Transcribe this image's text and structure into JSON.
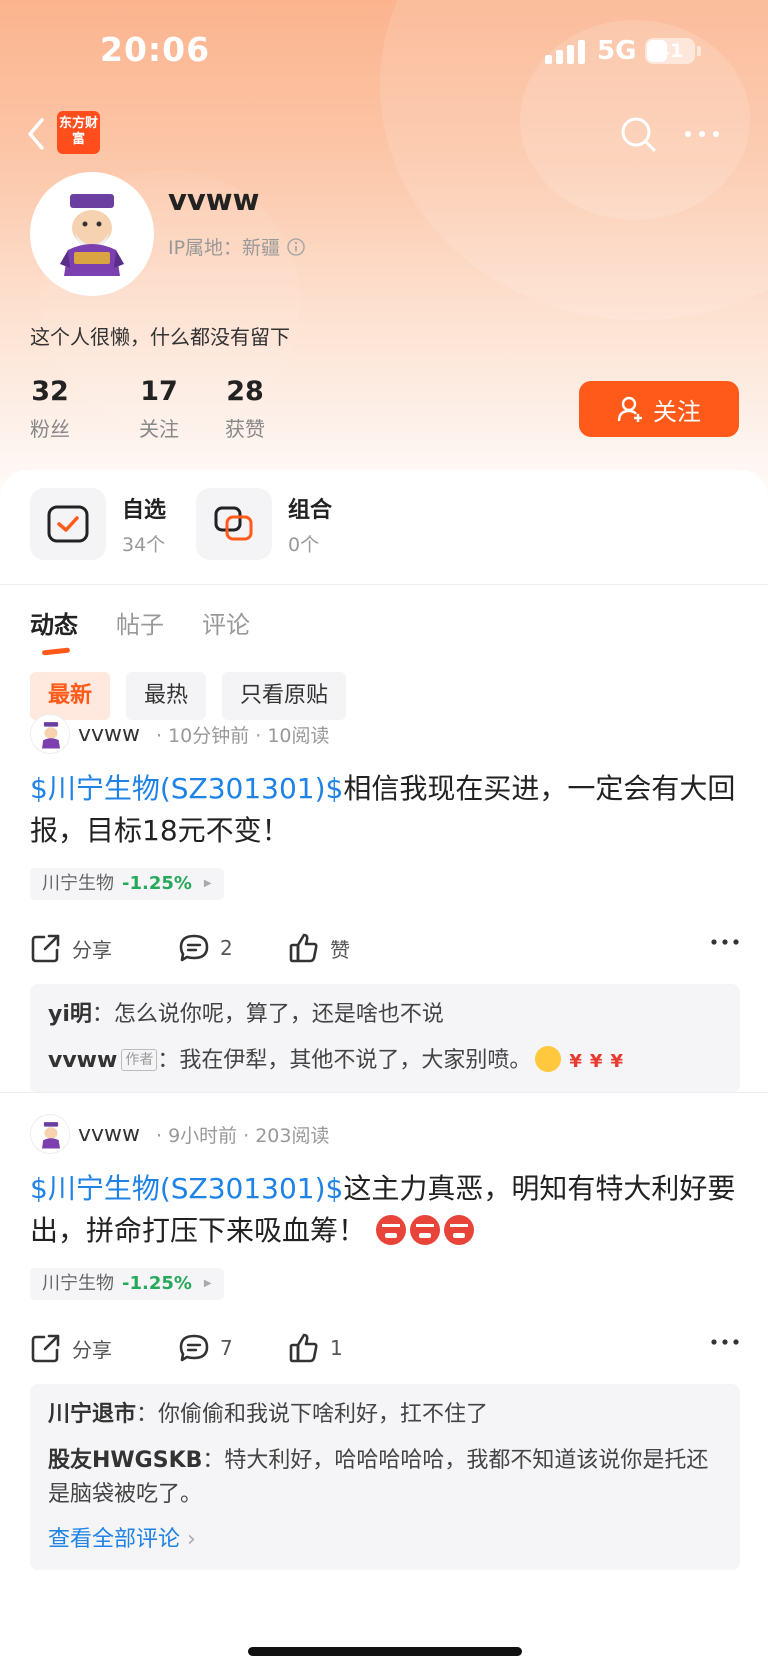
{
  "status_bar": {
    "time": "20:06",
    "network": "5G",
    "battery": "41"
  },
  "nav": {
    "logo_text": "东方财富"
  },
  "profile": {
    "username": "vvww",
    "ip_location": "IP属地：新疆",
    "bio": "这个人很懒，什么都没有留下",
    "stats": [
      {
        "value": "32",
        "label": "粉丝"
      },
      {
        "value": "17",
        "label": "关注"
      },
      {
        "value": "28",
        "label": "获赞"
      }
    ],
    "follow_label": "关注"
  },
  "shortcuts": [
    {
      "title": "自选",
      "count": "34个"
    },
    {
      "title": "组合",
      "count": "0个"
    }
  ],
  "tabs": [
    "动态",
    "帖子",
    "评论"
  ],
  "filters": [
    "最新",
    "最热",
    "只看原贴"
  ],
  "posts": [
    {
      "user": "vvww",
      "time": "10分钟前",
      "reads": "10阅读",
      "stock_tag": "$川宁生物(SZ301301)$",
      "text": "相信我现在买进，一定会有大回报，目标18元不变！",
      "chip_name": "川宁生物",
      "chip_change": "-1.25%",
      "share": "分享",
      "comments": "2",
      "likes": "赞",
      "reply_list": [
        {
          "name": "yi明",
          "text": "怎么说你呢，算了，还是啥也不说"
        },
        {
          "name": "vvww",
          "badge": "作者",
          "text": "我在伊犁，其他不说了，大家别喷。"
        }
      ]
    },
    {
      "user": "vvww",
      "time": "9小时前",
      "reads": "203阅读",
      "stock_tag": "$川宁生物(SZ301301)$",
      "text": "这主力真恶，明知有特大利好要出，拼命打压下来吸血筹！",
      "chip_name": "川宁生物",
      "chip_change": "-1.25%",
      "share": "分享",
      "comments": "7",
      "likes": "1",
      "reply_list": [
        {
          "name": "川宁退市",
          "text": "你偷偷和我说下啥利好，扛不住了"
        },
        {
          "name": "股友HWGSKB",
          "text": "特大利好，哈哈哈哈哈，我都不知道该说你是托还是脑袋被吃了。"
        }
      ],
      "view_all": "查看全部评论"
    }
  ],
  "icons": {
    "back": "chevron-left-icon",
    "search": "search-icon",
    "more": "more-dots-icon",
    "info": "info-icon",
    "share": "share-icon",
    "comment": "comment-icon",
    "like": "thumbs-up-icon"
  },
  "colors": {
    "accent": "#ff5a1a",
    "link": "#1e82e6",
    "down": "#27a85a"
  }
}
